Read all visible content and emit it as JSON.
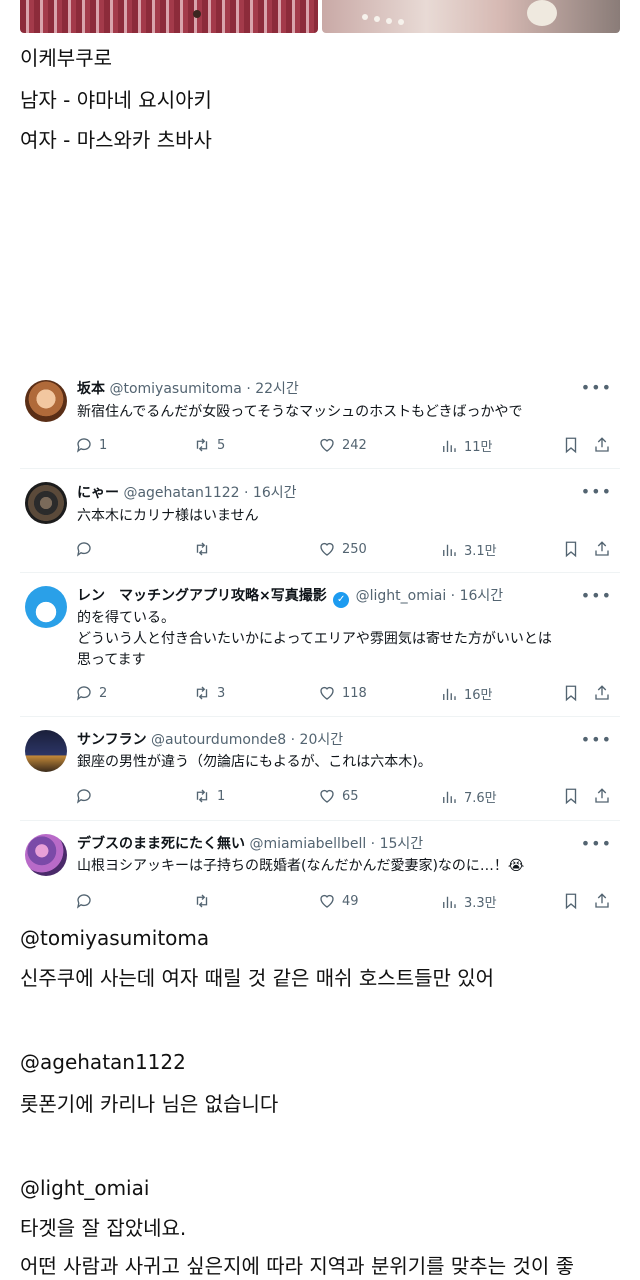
{
  "post": {
    "lines": [
      "이케부쿠로",
      "남자 - 야마네 요시아키",
      "여자 - 마스와카 츠바사"
    ]
  },
  "tweets": [
    {
      "name": "坂本",
      "handle": "@tomiyasumitoma",
      "time": "22시간",
      "text": "新宿住んでるんだが女殴ってそうなマッシュのホストもどきばっかやで",
      "replies": "1",
      "retweets": "5",
      "likes": "242",
      "views": "11만",
      "verified": false,
      "avatar_icon": "screaming-face-avatar"
    },
    {
      "name": "にゃー",
      "handle": "@agehatan1122",
      "time": "16시간",
      "text": "六本木にカリナ様はいません",
      "replies": "",
      "retweets": "",
      "likes": "250",
      "views": "3.1만",
      "verified": false,
      "avatar_icon": "dark-pattern-avatar"
    },
    {
      "name": "レン　マッチングアプリ攻略×写真撮影",
      "handle": "@light_omiai",
      "time": "16시간",
      "text": "的を得ている。\nどういう人と付き合いたいかによってエリアや雰囲気は寄せた方がいいとは\n思ってます",
      "replies": "2",
      "retweets": "3",
      "likes": "118",
      "views": "16만",
      "verified": true,
      "avatar_icon": "doraemon-avatar"
    },
    {
      "name": "サンフラン",
      "handle": "@autourdumonde8",
      "time": "20시간",
      "text": "銀座の男性が違う（勿論店にもよるが、これは六本木)。",
      "replies": "",
      "retweets": "1",
      "likes": "65",
      "views": "7.6만",
      "verified": false,
      "avatar_icon": "night-tower-avatar"
    },
    {
      "name": "デブスのまま死にたく無い",
      "handle": "@miamiabellbell",
      "time": "15시간",
      "text": "山根ヨシアッキーは子持ちの既婚者(なんだかんだ愛妻家)なのに…！😭",
      "replies": "",
      "retweets": "",
      "likes": "49",
      "views": "3.3만",
      "verified": false,
      "avatar_icon": "flower-bouquet-avatar"
    }
  ],
  "translations": [
    {
      "handle": "@tomiyasumitoma",
      "lines": [
        "신주쿠에 사는데 여자 때릴 것 같은 매쉬 호스트들만 있어"
      ]
    },
    {
      "handle": "@agehatan1122",
      "lines": [
        "롯폰기에 카리나 님은 없습니다"
      ]
    },
    {
      "handle": "@light_omiai",
      "lines": [
        "타겟을 잘 잡았네요.",
        "어떤 사람과 사귀고 싶은지에 따라 지역과 분위기를 맞추는 것이 좋"
      ]
    }
  ],
  "colors": {
    "meta_gray": "#536471",
    "verified_blue": "#1d9bf0",
    "divider": "#eff3f4"
  }
}
